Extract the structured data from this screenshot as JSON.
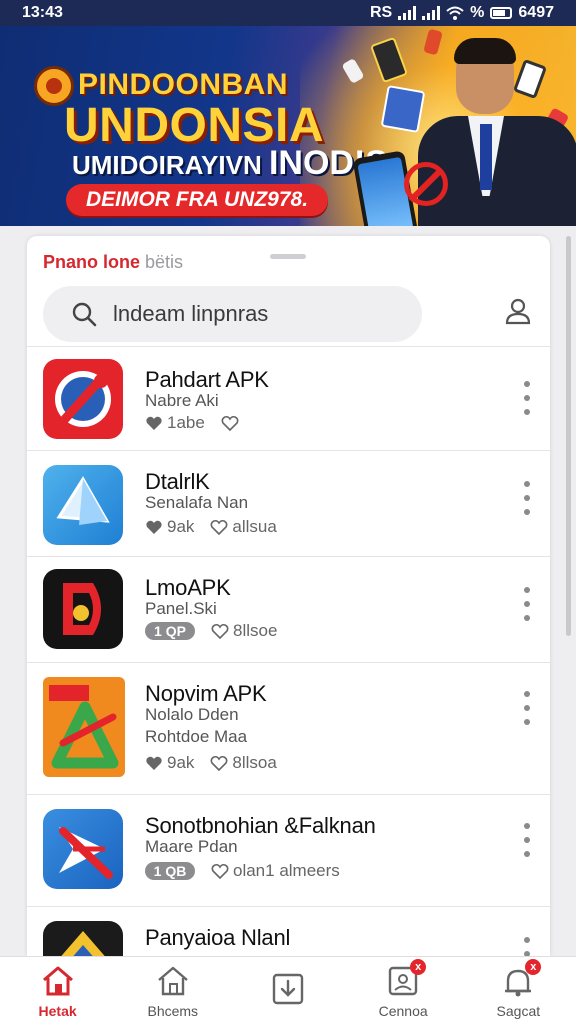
{
  "status_bar": {
    "time": "13:43",
    "carrier": "RS",
    "wifi_label": "%",
    "battery_text": "6497"
  },
  "banner": {
    "line1": "PINDOONBAN",
    "line2": "UNDONSIA",
    "line3_small": "UMIDOIRAYIVN",
    "line3_big": "INOD!S",
    "cta": "DEIMOR FRA UNZ978."
  },
  "sheet": {
    "title_red": "Pnano",
    "title_mid": " lone",
    "title_gray": " bëtis",
    "search_placeholder": "lndeam linpnras"
  },
  "apps": [
    {
      "name": "Pahdart APK",
      "sub": "Nabre Aki",
      "rating": "1abe",
      "downloads": "",
      "size_badge": "",
      "icon": "red-blue-wrench-icon"
    },
    {
      "name": "DtalrlK",
      "sub": "Senalafa Nan",
      "rating": "9ak",
      "downloads": "allsua",
      "size_badge": "",
      "icon": "blue-paper-plane-icon"
    },
    {
      "name": "LmoAPK",
      "sub": "Panel.Ski",
      "rating": "",
      "downloads": "8llsoe",
      "size_badge": "1 QP",
      "icon": "red-black-d-icon"
    },
    {
      "name": "Nopvim APK",
      "sub": "Nolalo Dden",
      "sub2": "Rohtdoe Maa",
      "rating": "9ak",
      "downloads": "8llsoa",
      "size_badge": "",
      "icon": "orange-green-a-icon"
    },
    {
      "name": "Sonotbnohian &Falknan",
      "sub": "Maare Pdan",
      "rating": "",
      "downloads": "olan1 almeers",
      "size_badge": "1 QB",
      "icon": "blue-red-star-icon"
    },
    {
      "name": "Panyaioa Nlanl",
      "sub": "",
      "rating": "",
      "downloads": "",
      "size_badge": "",
      "icon": "dark-yellow-icon"
    }
  ],
  "nav": [
    {
      "label": "Hetak",
      "icon": "home-icon",
      "active": true,
      "badge": ""
    },
    {
      "label": "Bhcems",
      "icon": "store-icon",
      "active": false,
      "badge": ""
    },
    {
      "label": "",
      "icon": "download-box-icon",
      "active": false,
      "badge": ""
    },
    {
      "label": "Cennoa",
      "icon": "inbox-icon",
      "active": false,
      "badge": "x"
    },
    {
      "label": "Sagcat",
      "icon": "profile-bell-icon",
      "active": false,
      "badge": "x"
    }
  ],
  "colors": {
    "accent": "#d6282f",
    "banner_blue": "#12368a",
    "banner_orange": "#f0a21b",
    "status_bar": "#1d2a55"
  }
}
